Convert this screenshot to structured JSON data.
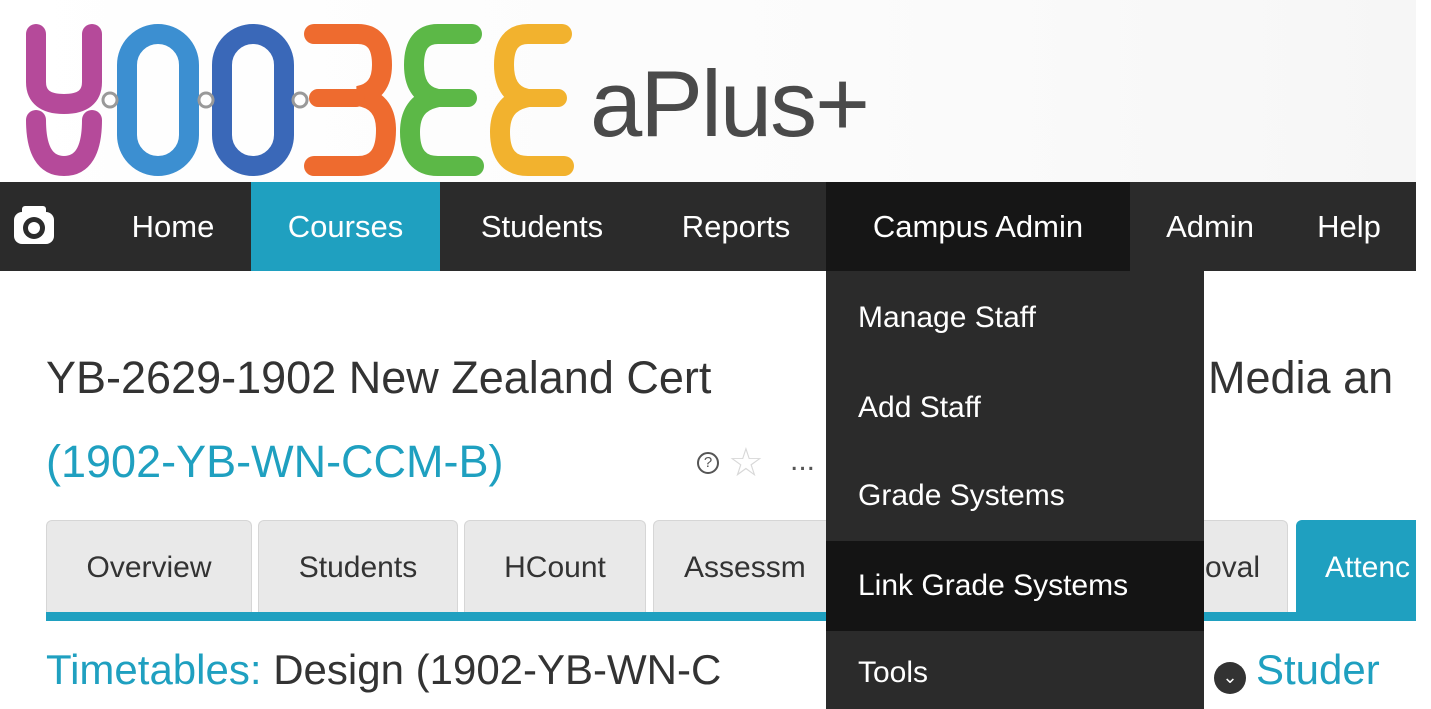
{
  "header": {
    "logo_text": "YOOBEE",
    "product_name": "aPlus+",
    "logo_colors": [
      "#b54a9a",
      "#3c8fd1",
      "#3a68b8",
      "#ee6b2f",
      "#5cb847",
      "#f2b22e"
    ]
  },
  "navbar": {
    "logo_icon": "camera-logo-icon",
    "items": [
      {
        "label": "Home"
      },
      {
        "label": "Courses"
      },
      {
        "label": "Students"
      },
      {
        "label": "Reports"
      },
      {
        "label": "Campus Admin"
      },
      {
        "label": "Admin"
      },
      {
        "label": "Help"
      }
    ],
    "active": "Courses",
    "open": "Campus Admin"
  },
  "dropdown": {
    "items": [
      {
        "label": "Manage Staff"
      },
      {
        "label": "Add Staff"
      },
      {
        "label": "Grade Systems"
      },
      {
        "label": "Link Grade Systems"
      },
      {
        "label": "Tools"
      }
    ],
    "highlighted": "Link Grade Systems"
  },
  "course": {
    "title_left": "YB-2629-1902 New Zealand Cert",
    "title_right": "Media an",
    "code": "(1902-YB-WN-CCM-B)",
    "help_icon": "question-circle-icon",
    "favorite_icon": "star-outline-icon",
    "more": "..."
  },
  "tabs": [
    {
      "label": "Overview"
    },
    {
      "label": "Students"
    },
    {
      "label": "HCount"
    },
    {
      "label": "Assessm"
    },
    {
      "label": "oval"
    },
    {
      "label": "Attenc"
    }
  ],
  "active_tab": "Attenc",
  "timetables": {
    "label": "Timetables:",
    "value": "Design (1902-YB-WN-C",
    "dropdown_icon": "chevron-down-circle-icon",
    "link": "Studer"
  },
  "colors": {
    "accent": "#1fa0c0",
    "navbar": "#2b2b2b",
    "dropdown_highlight": "#141414",
    "text": "#333333"
  }
}
